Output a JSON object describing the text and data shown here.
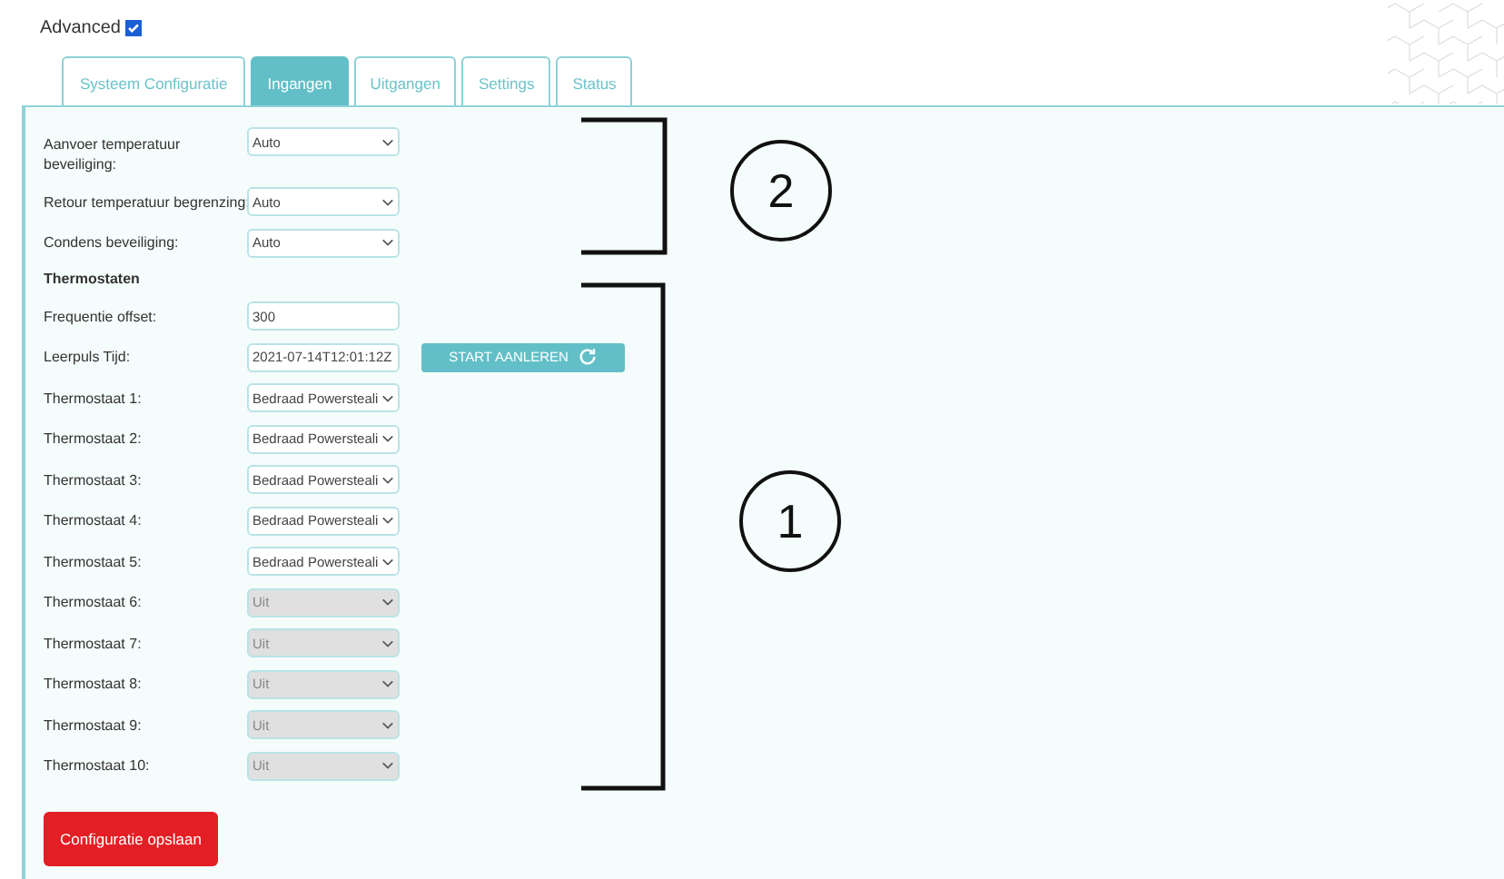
{
  "advanced": {
    "label": "Advanced",
    "checked": true
  },
  "tabs": [
    {
      "label": "Systeem Configuratie",
      "selected": false
    },
    {
      "label": "Ingangen",
      "selected": true
    },
    {
      "label": "Uitgangen",
      "selected": false
    },
    {
      "label": "Settings",
      "selected": false
    },
    {
      "label": "Status",
      "selected": false
    }
  ],
  "general_fields": [
    {
      "label": "Aanvoer temperatuur beveiliging:",
      "kind": "select",
      "value": "Auto",
      "disabled": false
    },
    {
      "label": "Retour temperatuur begrenzing:",
      "kind": "select",
      "value": "Auto",
      "disabled": false
    },
    {
      "label": "Condens beveiliging:",
      "kind": "select",
      "value": "Auto",
      "disabled": false
    }
  ],
  "section_title": "Thermostaten",
  "thermostat_fields": [
    {
      "label": "Frequentie offset:",
      "kind": "input",
      "value": "300",
      "disabled": false
    },
    {
      "label": "Leerpuls Tijd:",
      "kind": "input",
      "value": "2021-07-14T12:01:12Z",
      "disabled": false,
      "button": "START AANLEREN"
    },
    {
      "label": "Thermostaat 1:",
      "kind": "select",
      "value": "Bedraad Powersteali",
      "disabled": false
    },
    {
      "label": "Thermostaat 2:",
      "kind": "select",
      "value": "Bedraad Powersteali",
      "disabled": false
    },
    {
      "label": "Thermostaat 3:",
      "kind": "select",
      "value": "Bedraad Powersteali",
      "disabled": false
    },
    {
      "label": "Thermostaat 4:",
      "kind": "select",
      "value": "Bedraad Powersteali",
      "disabled": false
    },
    {
      "label": "Thermostaat 5:",
      "kind": "select",
      "value": "Bedraad Powersteali",
      "disabled": false
    },
    {
      "label": "Thermostaat 6:",
      "kind": "select",
      "value": "Uit",
      "disabled": true
    },
    {
      "label": "Thermostaat 7:",
      "kind": "select",
      "value": "Uit",
      "disabled": true
    },
    {
      "label": "Thermostaat 8:",
      "kind": "select",
      "value": "Uit",
      "disabled": true
    },
    {
      "label": "Thermostaat 9:",
      "kind": "select",
      "value": "Uit",
      "disabled": true
    },
    {
      "label": "Thermostaat 10:",
      "kind": "select",
      "value": "Uit",
      "disabled": true
    }
  ],
  "save_button": "Configuratie opslaan",
  "annotations": [
    {
      "label": "2"
    },
    {
      "label": "1"
    }
  ]
}
